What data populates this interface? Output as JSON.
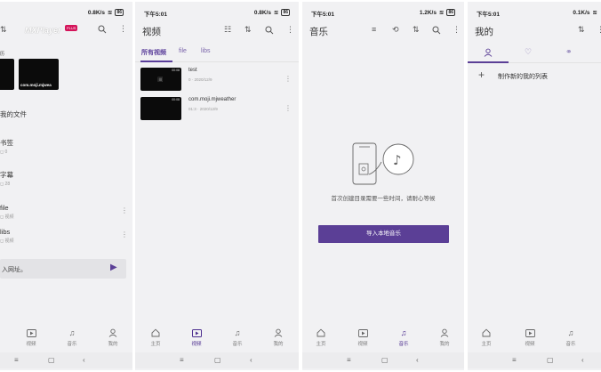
{
  "status": [
    {
      "time": "",
      "speed": "0.8K/s",
      "battery": "86"
    },
    {
      "time": "下午5:01",
      "speed": "0.8K/s",
      "battery": "86"
    },
    {
      "time": "下午5:01",
      "speed": "1.2K/s",
      "battery": "86"
    },
    {
      "time": "下午5:01",
      "speed": "0.1K/s",
      "battery": ""
    }
  ],
  "home": {
    "app_title": "MXPlayer",
    "badge": "PLUS",
    "section_label": "历",
    "recent_video_label": "com.moji.mjwea",
    "menu": [
      {
        "label": "我的文件",
        "sub": ""
      },
      {
        "label": "书签",
        "sub": "0"
      },
      {
        "label": "字幕",
        "sub": "28"
      },
      {
        "label": "file",
        "sub": "视频"
      },
      {
        "label": "libs",
        "sub": "视频"
      }
    ],
    "url_placeholder": "入网址。",
    "nav": [
      "视频",
      "音乐",
      "我的"
    ]
  },
  "videos": {
    "title": "视频",
    "tabs": [
      "所有视频",
      "file",
      "libs"
    ],
    "items": [
      {
        "title": "test",
        "meta": "0 · 2020/12/9",
        "duration": "00:08"
      },
      {
        "title": "com.moji.mjweather",
        "meta": "01:3 · 2020/12/9",
        "duration": "00:08"
      }
    ],
    "nav": [
      "主页",
      "视频",
      "音乐",
      "我的"
    ]
  },
  "music": {
    "title": "音乐",
    "empty_text": "首次创建目录需要一些时间，请耐心等候",
    "import_label": "导入本地音乐",
    "nav": [
      "主页",
      "视频",
      "音乐",
      "我的"
    ]
  },
  "mine": {
    "title": "我的",
    "create_label": "制作新的我的列表",
    "nav": [
      "主页",
      "视频",
      "音乐"
    ]
  },
  "accent": "#5b3f96"
}
